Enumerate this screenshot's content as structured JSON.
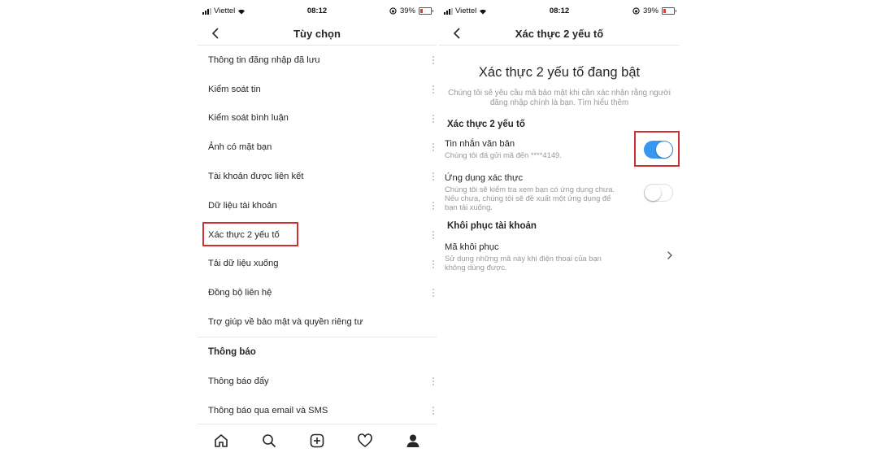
{
  "left": {
    "status": {
      "carrier": "Viettel",
      "time": "08:12",
      "battery": "39%"
    },
    "nav": {
      "title": "Tùy chọn"
    },
    "menu_items": [
      "Thông tin đăng nhập đã lưu",
      "Kiểm soát tin",
      "Kiểm soát bình luận",
      "Ảnh có mặt bạn",
      "Tài khoản được liên kết",
      "Dữ liệu tài khoản",
      "Xác thực 2 yếu tố",
      "Tải dữ liệu xuống",
      "Đồng bộ liên hệ",
      "Trợ giúp về bảo mật và quyền riêng tư"
    ],
    "section_notifications": "Thông báo",
    "notification_items": [
      "Thông báo đẩy",
      "Thông báo qua email và SMS"
    ],
    "tabs": [
      "home-icon",
      "search-icon",
      "add-post-icon",
      "heart-icon",
      "profile-icon"
    ]
  },
  "right": {
    "status": {
      "carrier": "Viettel",
      "time": "08:12",
      "battery": "39%"
    },
    "nav": {
      "title": "Xác thực 2 yếu tố"
    },
    "heading": "Xác thực 2 yếu tố đang bật",
    "description": "Chúng tôi sẽ yêu cầu mã bảo mật khi cần xác nhận rằng người đăng nhập chính là bạn. Tìm hiểu thêm",
    "section_2fa": "Xác thực 2 yếu tố",
    "sms": {
      "title": "Tin nhắn văn bản",
      "desc": "Chúng tôi đã gửi mã đến ****4149.",
      "enabled": true
    },
    "auth_app": {
      "title": "Ứng dụng xác thực",
      "desc": "Chúng tôi sẽ kiểm tra xem bạn có ứng dụng chưa. Nếu chưa, chúng tôi sẽ đề xuất một ứng dụng để bạn tải xuống.",
      "enabled": false
    },
    "section_recovery": "Khôi phục tài khoản",
    "recovery": {
      "title": "Mã khôi phục",
      "desc": "Sử dụng những mã này khi điện thoại của bạn không dùng được."
    }
  },
  "colors": {
    "accent": "#3897f0",
    "highlight": "#d32f2f"
  }
}
